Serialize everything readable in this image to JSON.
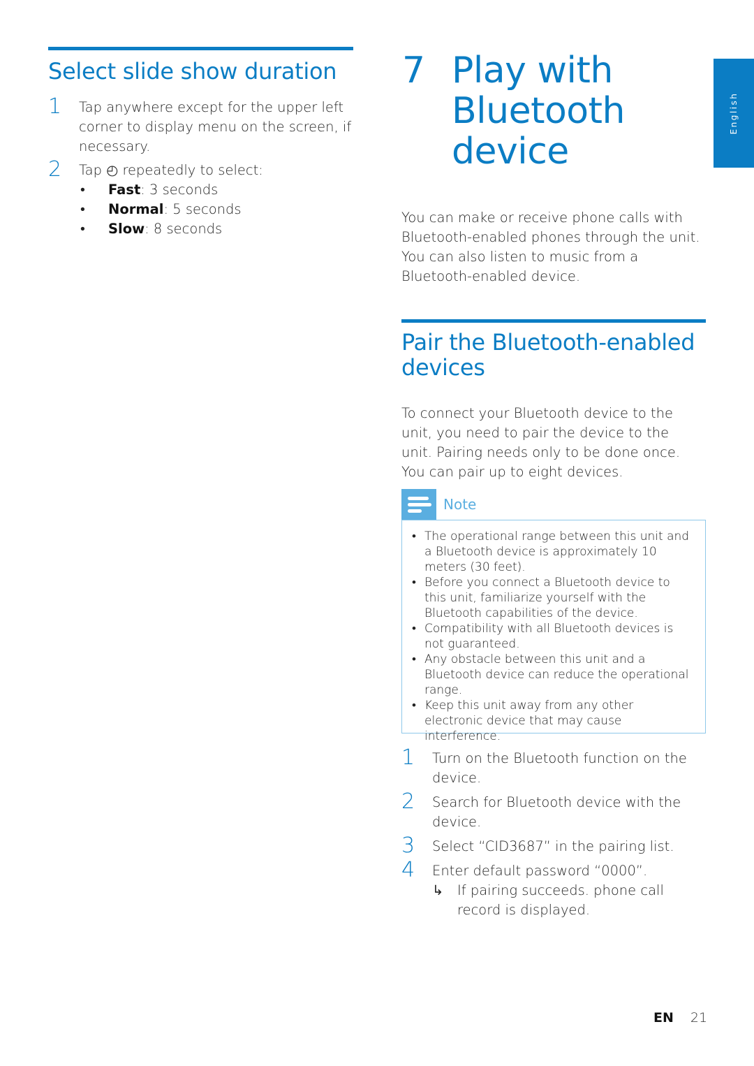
{
  "left": {
    "heading": "Select slide show duration",
    "steps": [
      {
        "num": "1",
        "text": "Tap anywhere except for the upper left corner to display menu on the screen, if necessary."
      },
      {
        "num": "2",
        "text_before": "Tap",
        "icon": "clock-icon",
        "icon_glyph": "◴",
        "text_after": "repeatedly to select:"
      }
    ],
    "options": [
      {
        "name": "Fast",
        "value": ": 3 seconds"
      },
      {
        "name": "Normal",
        "value": ": 5 seconds"
      },
      {
        "name": "Slow",
        "value": ": 8 seconds"
      }
    ]
  },
  "chapter": {
    "number": "7",
    "title_lines": [
      "Play with",
      "Bluetooth",
      "device"
    ]
  },
  "side_tab": {
    "label": "English"
  },
  "intro": "You can make or receive phone calls with Bluetooth-enabled phones through the unit. You can also listen to music from a Bluetooth-enabled device.",
  "pair": {
    "heading": "Pair the Bluetooth-enabled devices",
    "para1": "To connect your Bluetooth device to the unit, you need to pair the device to the unit. Pairing needs only to be done once.",
    "para2": "You can pair up to eight devices.",
    "note": {
      "label": "Note",
      "items": [
        "The operational range between this unit and a Bluetooth device is approximately 10 meters (30 feet).",
        "Before you connect a Bluetooth device to this unit, familiarize yourself with the Bluetooth capabilities of the device.",
        "Compatibility with all Bluetooth devices is not guaranteed.",
        "Any obstacle between this unit and a Bluetooth device can reduce the operational range.",
        "Keep this unit away from any other electronic device that may cause interference."
      ]
    },
    "steps": [
      {
        "num": "1",
        "text": "Turn on the Bluetooth function on the device."
      },
      {
        "num": "2",
        "text": "Search for Bluetooth device with the device."
      },
      {
        "num": "3",
        "text": "Select “CID3687” in the pairing list."
      },
      {
        "num": "4",
        "text": "Enter default password “0000”."
      }
    ],
    "result_arrow": "↳",
    "result": "If pairing succeeds. phone call record is displayed."
  },
  "footer": {
    "lang": "EN",
    "page": "21"
  },
  "colors": {
    "accent": "#0b7dc4",
    "note_accent": "#5aaee0",
    "note_border": "#8ec8ea"
  }
}
